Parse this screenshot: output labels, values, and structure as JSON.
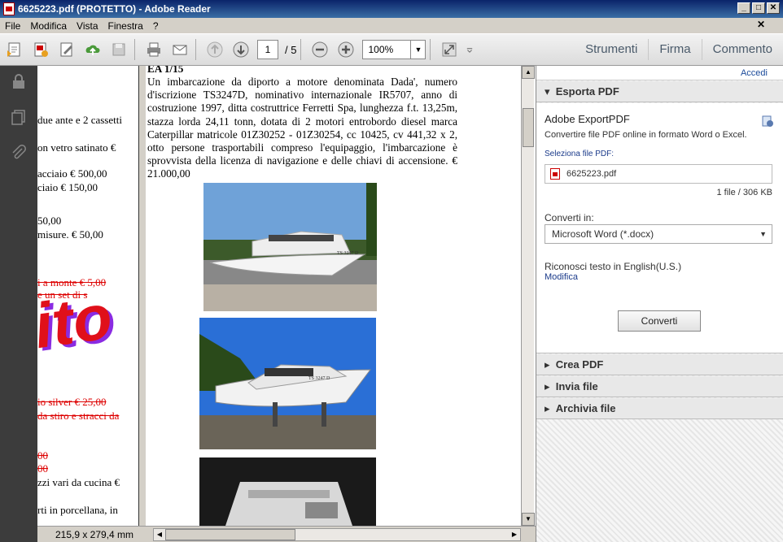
{
  "window": {
    "title": "6625223.pdf (PROTETTO) - Adobe Reader"
  },
  "menu": {
    "items": [
      "File",
      "Modifica",
      "Vista",
      "Finestra",
      "?"
    ]
  },
  "toolbar": {
    "page_current": "1",
    "page_total": "/ 5",
    "zoom": "100%",
    "icons": [
      "create-pdf-icon",
      "export-icon",
      "sign-icon",
      "upload-icon",
      "save-icon",
      "print-icon",
      "email-icon",
      "prev-page-icon",
      "next-page-icon",
      "zoom-out-icon",
      "zoom-in-icon",
      "fullscreen-icon",
      "more-icon"
    ]
  },
  "tabs": {
    "tools": "Strumenti",
    "sign": "Firma",
    "comment": "Commento"
  },
  "leftnav": {
    "icons": [
      "lock-icon",
      "pages-icon",
      "attachment-icon"
    ]
  },
  "page1": {
    "lines": [
      "due ante e 2 cassetti",
      "on vetro satinato €",
      "acciaio € 500,00",
      "ciaio € 150,00",
      "50,00",
      "misure. €  50,00",
      "i a monte €  5,00",
      "e un set di s",
      "io  silver €  25,00",
      "da stiro e stracci da",
      "00",
      "00",
      "zzi vari da cucina €",
      "rti  in porcellana,  in"
    ],
    "stamp": "ito"
  },
  "page2": {
    "heading": "EA 1/15",
    "text": "Un imbarcazione da diporto a motore denominata Dada', numero d'iscrizione TS3247D, nominativo internazionale IR5707, anno di costruzione 1997, ditta costruttrice Ferretti Spa, lunghezza f.t. 13,25m, stazza lorda 24,11 tonn, dotata di 2 motori entrobordo diesel marca Caterpillar matricole 01Z30252 - 01Z30254,  cc 10425, cv 441,32 x 2, otto persone trasportabili compreso l'equipaggio, l'imbarcazione è sprovvista della licenza di navigazione e delle chiavi di accensione. € 21.000,00",
    "photo_text": [
      "TS 3247 D",
      "TS 3247 D"
    ]
  },
  "status": {
    "dimensions": "215,9 x 279,4 mm"
  },
  "rightpane": {
    "login": "Accedi",
    "export_section": "Esporta PDF",
    "export_title": "Adobe ExportPDF",
    "export_desc": "Convertire file PDF online in formato Word o Excel.",
    "select_label": "Seleziona file PDF:",
    "file_name": "6625223.pdf",
    "file_info": "1 file / 306 KB",
    "convert_to_label": "Converti in:",
    "format": "Microsoft Word (*.docx)",
    "ocr_text": "Riconosci testo in English(U.S.)",
    "modify_link": "Modifica",
    "convert_button": "Converti",
    "sections": [
      "Crea PDF",
      "Invia file",
      "Archivia file"
    ]
  }
}
